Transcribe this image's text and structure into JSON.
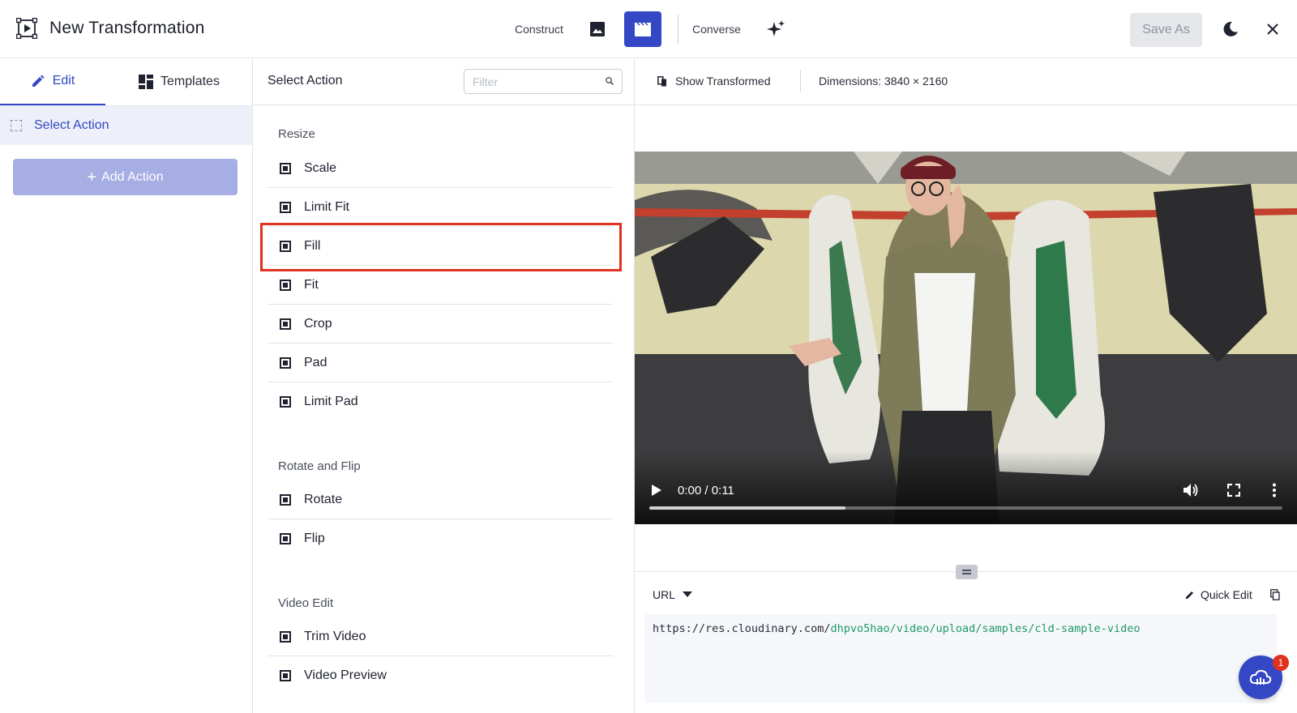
{
  "header": {
    "title": "New Transformation",
    "modes": {
      "construct": "Construct",
      "converse": "Converse"
    },
    "save_as": "Save As"
  },
  "left": {
    "tabs": {
      "edit": "Edit",
      "templates": "Templates"
    },
    "current_action": "Select Action",
    "add_action": "Add Action"
  },
  "middle": {
    "title": "Select Action",
    "filter_placeholder": "Filter",
    "sections": {
      "resize": {
        "title": "Resize",
        "items": [
          "Scale",
          "Limit Fit",
          "Fill",
          "Fit",
          "Crop",
          "Pad",
          "Limit Pad"
        ]
      },
      "rotate": {
        "title": "Rotate and Flip",
        "items": [
          "Rotate",
          "Flip"
        ]
      },
      "video": {
        "title": "Video Edit",
        "items": [
          "Trim Video",
          "Video Preview"
        ]
      }
    },
    "highlighted_item": "Fill"
  },
  "right": {
    "show_transformed": "Show Transformed",
    "dimensions": "Dimensions: 3840 × 2160",
    "video": {
      "time": "0:00 / 0:11",
      "buffered_fraction": 0.31
    },
    "url_mode": "URL",
    "quick_edit": "Quick Edit",
    "url": {
      "base": "https://res.cloudinary.com/",
      "path": "dhpvo5hao/video/upload/samples/cld-sample-video"
    },
    "chat_badge": "1"
  },
  "colors": {
    "accent": "#3448c5",
    "highlight_border": "#e0321f",
    "url_path": "#1f9a6a",
    "add_action_bg": "#a6aee3"
  },
  "icons": {
    "app": "transformation-frame-icon",
    "image_mode": "image-icon",
    "video_mode": "clapperboard-icon",
    "ai": "sparkle-icon",
    "theme": "moon-icon",
    "close": "close-icon"
  }
}
